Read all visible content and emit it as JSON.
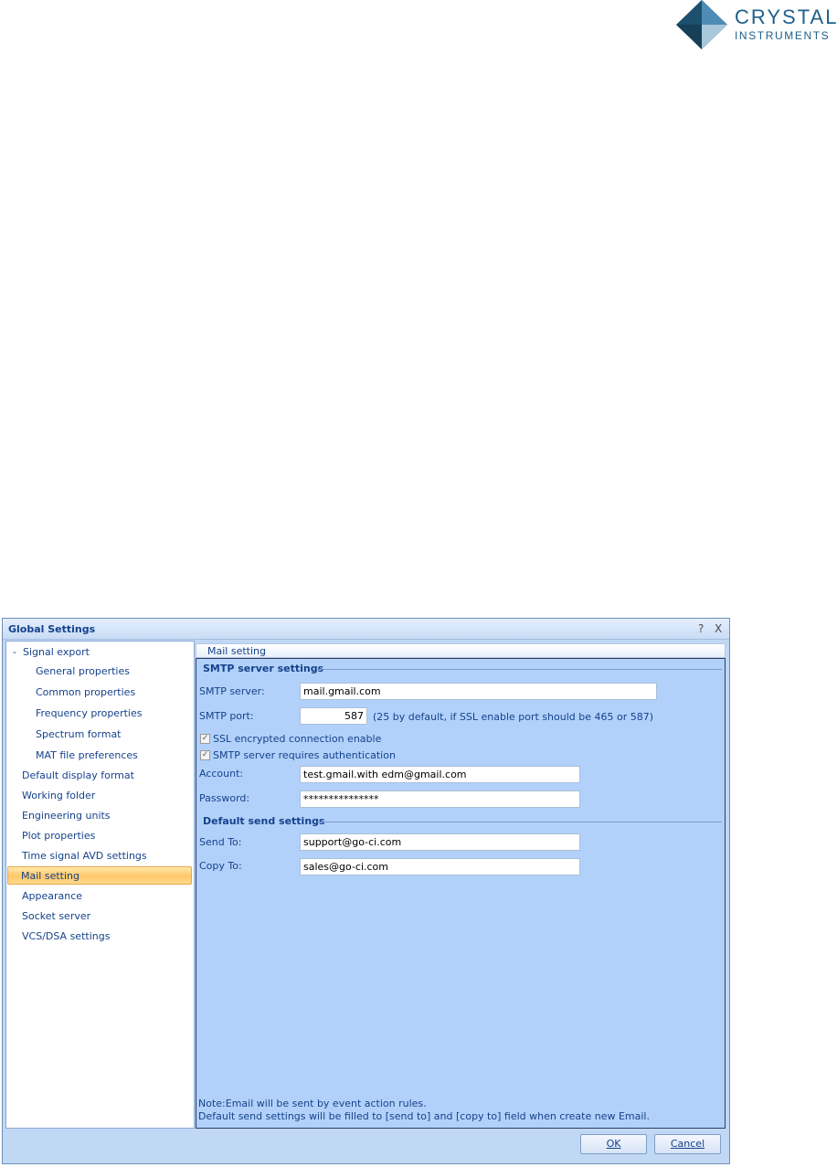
{
  "logo": {
    "line1": "CRYSTAL",
    "line2": "INSTRUMENTS"
  },
  "dialog": {
    "title": "Global Settings",
    "help_glyph": "?",
    "close_glyph": "X"
  },
  "tree": {
    "toggle": "-",
    "items": [
      {
        "label": "Signal export"
      },
      {
        "label": "General properties"
      },
      {
        "label": "Common properties"
      },
      {
        "label": "Frequency properties"
      },
      {
        "label": "Spectrum format"
      },
      {
        "label": "MAT file preferences"
      },
      {
        "label": "Default display format"
      },
      {
        "label": "Working folder"
      },
      {
        "label": "Engineering units"
      },
      {
        "label": "Plot properties"
      },
      {
        "label": "Time signal AVD settings"
      },
      {
        "label": "Mail setting"
      },
      {
        "label": "Appearance"
      },
      {
        "label": "Socket server"
      },
      {
        "label": "VCS/DSA settings"
      }
    ],
    "selected": "Mail setting"
  },
  "panel": {
    "header": "Mail setting",
    "smtp": {
      "title": "SMTP server settings",
      "server_label": "SMTP server:",
      "server_value": "mail.gmail.com",
      "port_label": "SMTP port:",
      "port_value": "587",
      "port_hint": "(25 by default, if SSL enable port should be 465 or 587)",
      "ssl_label": "SSL encrypted connection enable",
      "ssl_checked": true,
      "auth_label": "SMTP server requires authentication",
      "auth_checked": true,
      "account_label": "Account:",
      "account_value": "test.gmail.with edm@gmail.com",
      "password_label": "Password:",
      "password_value": "***************"
    },
    "send": {
      "title": "Default send settings",
      "send_to_label": "Send To:",
      "send_to_value": "support@go-ci.com",
      "copy_to_label": "Copy To:",
      "copy_to_value": "sales@go-ci.com"
    },
    "note_line1": "Note:Email will be sent by event action rules.",
    "note_line2": "Default send settings will be filled to [send to] and [copy to] field when create new Email."
  },
  "buttons": {
    "ok": "OK",
    "cancel": "Cancel"
  },
  "colors": {
    "accent": "#15428b",
    "panel": "#b2d1fa",
    "selection": "#ffc86a"
  }
}
